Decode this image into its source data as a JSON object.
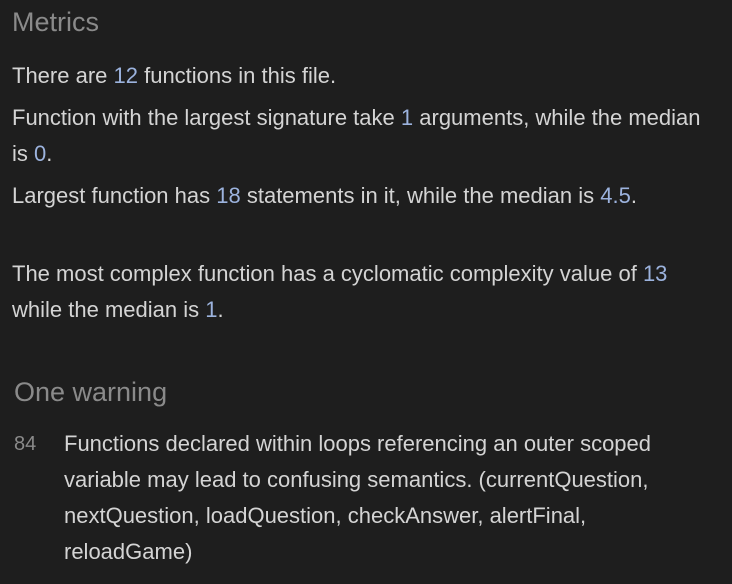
{
  "metrics": {
    "title": "Metrics",
    "functions_count": {
      "prefix": "There are ",
      "value": "12",
      "suffix": " functions in this file."
    },
    "signature": {
      "prefix": "Function with the largest signature take ",
      "value": "1",
      "middle": " arguments, while the median is ",
      "median": "0",
      "suffix": "."
    },
    "statements": {
      "prefix": "Largest function has ",
      "value": "18",
      "middle": " statements in it, while the median is ",
      "median": "4.5",
      "suffix": "."
    },
    "complexity": {
      "prefix": "The most complex function has a cyclomatic complexity value of ",
      "value": "13",
      "middle": " while the median is ",
      "median": "1",
      "suffix": "."
    }
  },
  "warnings": {
    "title": "One warning",
    "items": [
      {
        "line": "84",
        "message": "Functions declared within loops referencing an outer scoped variable may lead to confusing semantics. (currentQuestion, nextQuestion, loadQuestion, checkAnswer, alertFinal, reloadGame)"
      }
    ]
  }
}
